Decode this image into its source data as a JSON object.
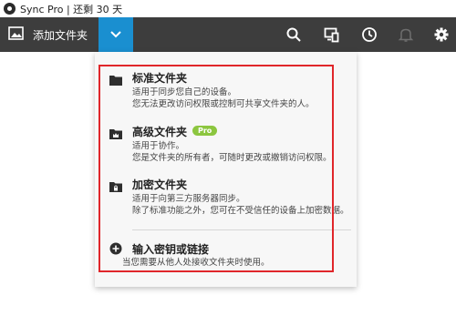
{
  "window": {
    "title": "Sync Pro | 还剩 30 天"
  },
  "toolbar": {
    "add_folder_label": "添加文件夹",
    "icons": [
      "search-icon",
      "devices-icon",
      "clock-icon",
      "bell-icon",
      "gear-icon"
    ]
  },
  "menu": {
    "options": [
      {
        "name": "标准文件夹",
        "desc1": "适用于同步您自己的设备。",
        "desc2": "您无法更改访问权限或控制可共享文件夹的人。"
      },
      {
        "name": "高级文件夹",
        "badge": "Pro",
        "desc1": "适用于协作。",
        "desc2": "您是文件夹的所有者，可随时更改或撤销访问权限。"
      },
      {
        "name": "加密文件夹",
        "desc1": "适用于向第三方服务器同步。",
        "desc2": "除了标准功能之外，您可在不受信任的设备上加密数据。"
      },
      {
        "name": "输入密钥或链接",
        "desc1": "当您需要从他人处接收文件夹时使用。"
      }
    ]
  },
  "colors": {
    "accent": "#1a8fd0",
    "toolbar": "#3d3d3d",
    "highlight": "#e0262a",
    "badge": "#8cc63f"
  }
}
